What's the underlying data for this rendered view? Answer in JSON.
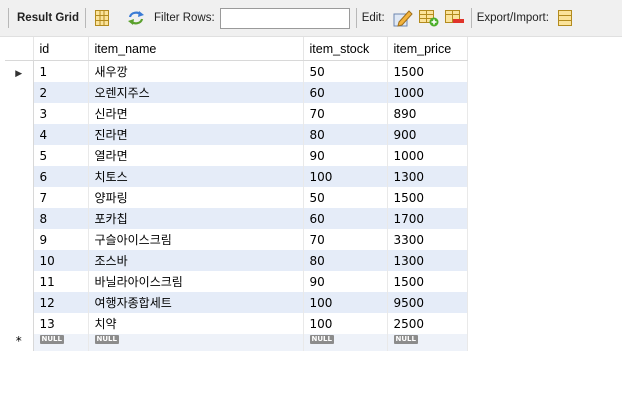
{
  "toolbar": {
    "result_grid_label": "Result Grid",
    "filter_rows_label": "Filter Rows:",
    "filter_rows_value": "",
    "edit_label": "Edit:",
    "export_import_label": "Export/Import:",
    "icons": [
      "grid-view-icon",
      "refresh-icon",
      "edit-row-icon",
      "add-row-icon",
      "delete-row-icon",
      "export-icon"
    ]
  },
  "grid": {
    "columns": [
      "id",
      "item_name",
      "item_stock",
      "item_price"
    ],
    "rows": [
      [
        "1",
        "새우깡",
        "50",
        "1500"
      ],
      [
        "2",
        "오렌지주스",
        "60",
        "1000"
      ],
      [
        "3",
        "신라면",
        "70",
        "890"
      ],
      [
        "4",
        "진라면",
        "80",
        "900"
      ],
      [
        "5",
        "열라면",
        "90",
        "1000"
      ],
      [
        "6",
        "치토스",
        "100",
        "1300"
      ],
      [
        "7",
        "양파링",
        "50",
        "1500"
      ],
      [
        "8",
        "포카칩",
        "60",
        "1700"
      ],
      [
        "9",
        "구슬아이스크림",
        "70",
        "3300"
      ],
      [
        "10",
        "조스바",
        "80",
        "1300"
      ],
      [
        "11",
        "바닐라아이스크림",
        "90",
        "1500"
      ],
      [
        "12",
        "여행자종합세트",
        "100",
        "9500"
      ],
      [
        "13",
        "치약",
        "100",
        "2500"
      ]
    ],
    "null_label": "NULL",
    "current_row_marker": "▶",
    "new_row_marker": "*",
    "stripe_color": "#e5ecf8"
  }
}
